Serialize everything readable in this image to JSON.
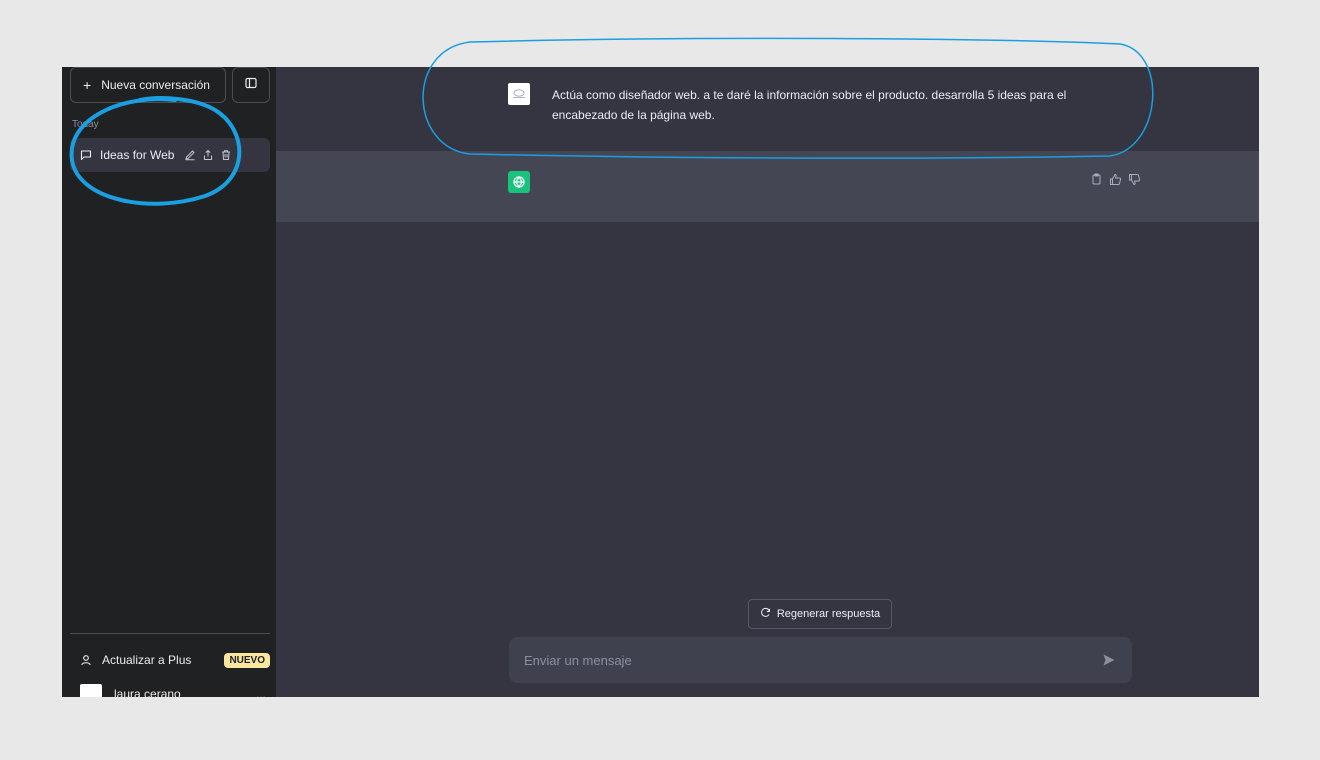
{
  "sidebar": {
    "new_chat_label": "Nueva conversación",
    "section_label": "Today",
    "conversations": [
      {
        "label": "Ideas for Web Heade"
      }
    ],
    "upgrade_label": "Actualizar a Plus",
    "upgrade_badge": "NUEVO",
    "account_name": "laura cerano",
    "account_more": "..."
  },
  "chat": {
    "user_message": "Actúa como diseñador web. a te daré la información sobre el producto. desarrolla 5 ideas para el encabezado de la página web."
  },
  "composer": {
    "regenerate_label": "Regenerar respuesta",
    "placeholder": "Enviar un mensaje"
  },
  "colors": {
    "sidebar_bg": "#202123",
    "main_bg": "#343541",
    "assistant_row_bg": "#444654",
    "assistant_avatar": "#19c37d",
    "badge_bg": "#fae69e",
    "annotation_stroke": "#1a9fe0"
  },
  "icons": [
    "plus-icon",
    "sidebar-toggle-icon",
    "chat-bubble-icon",
    "pencil-icon",
    "share-icon",
    "trash-icon",
    "user-icon",
    "openai-logo-icon",
    "copy-icon",
    "thumbs-up-icon",
    "thumbs-down-icon",
    "refresh-icon",
    "send-icon"
  ]
}
